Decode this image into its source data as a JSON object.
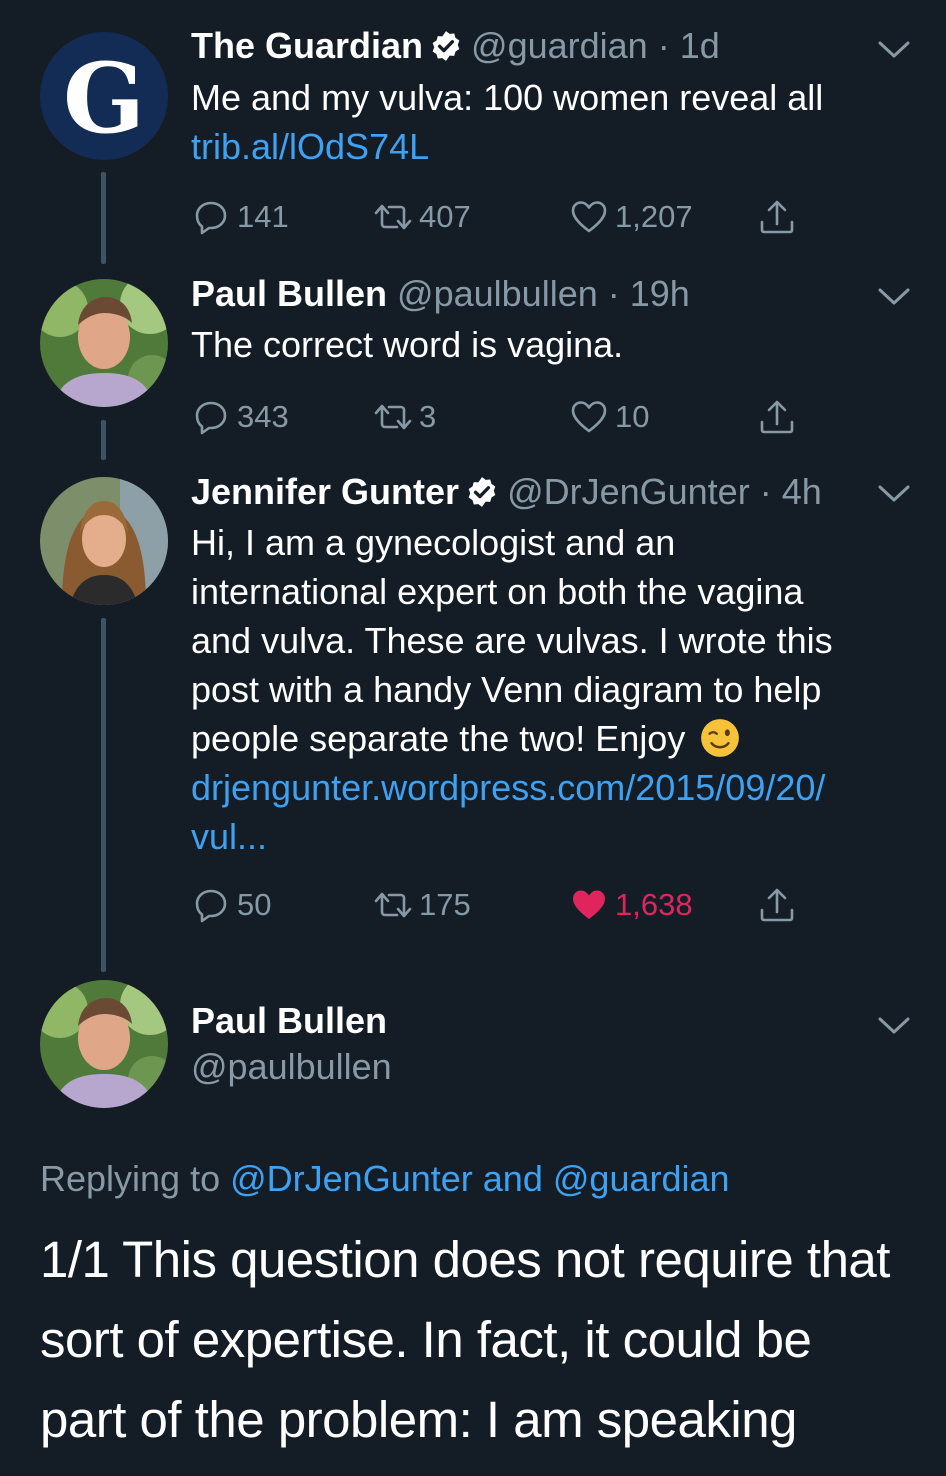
{
  "tweets": [
    {
      "name": "The Guardian",
      "verified": true,
      "handle": "@guardian",
      "time": "· 1d",
      "text": "Me and my vulva: 100 women reveal all",
      "link": "trib.al/lOdS74L",
      "replies": "141",
      "retweets": "407",
      "likes": "1,207",
      "liked": false,
      "avatar_letter": "G"
    },
    {
      "name": "Paul Bullen",
      "verified": false,
      "handle": "@paulbullen",
      "time": "· 19h",
      "text": "The correct word is vagina.",
      "replies": "343",
      "retweets": "3",
      "likes": "10",
      "liked": false
    },
    {
      "name": "Jennifer Gunter",
      "verified": true,
      "handle": "@DrJenGunter",
      "time": "· 4h",
      "text_lines": [
        "Hi, I am a gynecologist and an",
        "international expert on both the vagina",
        "and vulva. These are vulvas. I wrote this",
        "post with a handy Venn diagram to help",
        "people separate the two! Enjoy"
      ],
      "link_lines": [
        "drjengunter.wordpress.com/2015/09/20/",
        "vul..."
      ],
      "replies": "50",
      "retweets": "175",
      "likes": "1,638",
      "liked": true
    }
  ],
  "focused": {
    "name": "Paul Bullen",
    "handle": "@paulbullen",
    "replying_prefix": "Replying to",
    "replying_to_1": "@DrJenGunter",
    "replying_and": "and",
    "replying_to_2": "@guardian",
    "text_lines": [
      "1/1 This question does not require that",
      "sort of expertise. In fact, it could be",
      "part of the problem: I am speaking"
    ]
  },
  "colors": {
    "background": "#141d26",
    "link": "#3fa1f2",
    "muted": "#8899a6",
    "like": "#e0245e"
  }
}
